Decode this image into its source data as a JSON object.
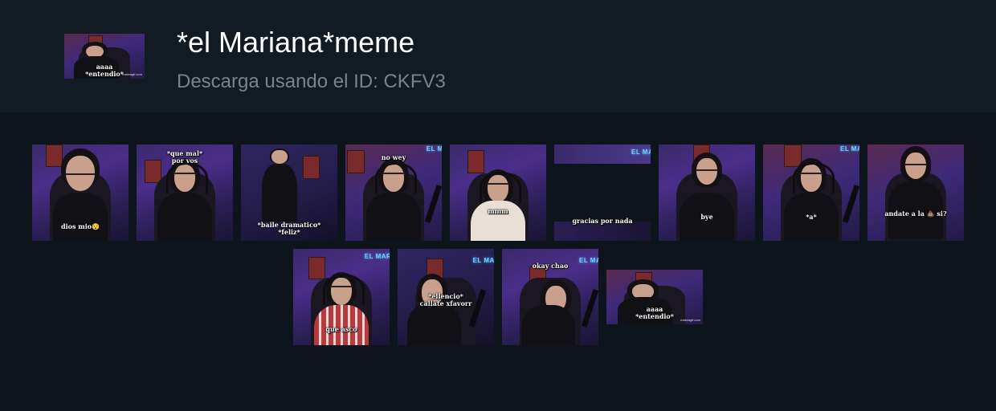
{
  "header": {
    "title": "*el Mariana*meme",
    "subtitle": "Descarga usando el ID: CKFV3",
    "thumbnail": {
      "caption": "aaaa\n*entendio*",
      "watermark": "makeagif.com"
    }
  },
  "gallery": {
    "items": [
      {
        "caption": "dios mio😯"
      },
      {
        "caption": "*que mal*\npor vos"
      },
      {
        "caption": "*baile dramatico*\n*feliz*"
      },
      {
        "caption": "no wey",
        "sign": "EL MARIANA"
      },
      {
        "caption": "mmm"
      },
      {
        "caption": "gracias por nada",
        "sign": "EL MARIANA"
      },
      {
        "caption": "bye"
      },
      {
        "caption": "*a*",
        "sign": "EL MARIANA"
      },
      {
        "caption": "andate a la 💩 si?"
      },
      {
        "caption": "que asco",
        "sign": "EL MARIANA"
      },
      {
        "caption": "*ellencio*\ncallate xfavorr",
        "sign": "EL MARIANA"
      },
      {
        "caption": "okay chao",
        "sign": "EL MARIANA"
      },
      {
        "caption": "aaaa\n*entendio*",
        "watermark": "makeagif.com"
      }
    ]
  }
}
